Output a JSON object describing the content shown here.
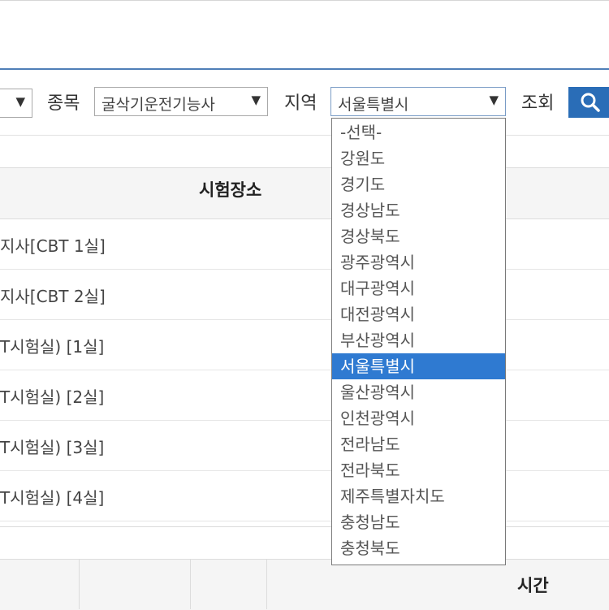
{
  "filters": {
    "left_arrow": "▼",
    "jongmok_label": "종목",
    "jongmok_value": "굴삭기운전기능사",
    "region_label": "지역",
    "region_value": "서울특별시",
    "search_label": "조회",
    "arrow": "▼"
  },
  "table": {
    "header": "시험장소",
    "rows": [
      "지사[CBT 1실]",
      "지사[CBT 2실]",
      "T시험실) [1실]",
      "T시험실) [2실]",
      "T시험실) [3실]",
      "T시험실) [4실]"
    ]
  },
  "table2": {
    "header_time": "시간"
  },
  "dropdown": {
    "options": [
      "-선택-",
      "강원도",
      "경기도",
      "경상남도",
      "경상북도",
      "광주광역시",
      "대구광역시",
      "대전광역시",
      "부산광역시",
      "서울특별시",
      "울산광역시",
      "인천광역시",
      "전라남도",
      "전라북도",
      "제주특별자치도",
      "충청남도",
      "충청북도"
    ],
    "selected_index": 9
  },
  "colors": {
    "accent": "#2a6db7",
    "selected": "#2f7ad1",
    "line": "#4f7fb7"
  },
  "icons": {
    "search": "search-icon"
  }
}
